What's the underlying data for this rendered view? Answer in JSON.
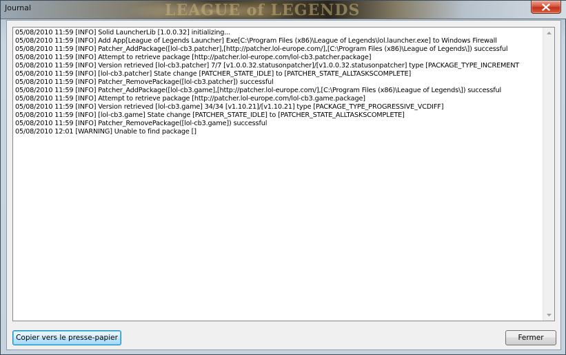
{
  "window": {
    "title": "Journal",
    "background_art_text": "LEAGUE of LEGENDS"
  },
  "log": {
    "lines": [
      "05/08/2010 11:59 [INFO] Solid LauncherLib [1.0.0.32] initializing...",
      "05/08/2010 11:59 [INFO] Add App[League of Legends Launcher] Exe[C:\\Program Files (x86)\\League of Legends\\lol.launcher.exe] to Windows Firewall",
      "05/08/2010 11:59 [INFO] Patcher_AddPackage([lol-cb3.patcher],[http://patcher.lol-europe.com/],[C:\\Program Files (x86)\\League of Legends\\]) successful",
      "05/08/2010 11:59 [INFO] Attempt to retrieve package [http://patcher.lol-europe.com/lol-cb3.patcher.package]",
      "05/08/2010 11:59 [INFO] Version retrieved [lol-cb3.patcher] 7/7 [v1.0.0.32.statusonpatcher]/[v1.0.0.32.statusonpatcher] type [PACKAGE_TYPE_INCREMENT",
      "05/08/2010 11:59 [INFO] [lol-cb3.patcher] State change [PATCHER_STATE_IDLE] to [PATCHER_STATE_ALLTASKSCOMPLETE]",
      "05/08/2010 11:59 [INFO] Patcher_RemovePackage([lol-cb3.patcher]) successful",
      "05/08/2010 11:59 [INFO] Patcher_AddPackage([lol-cb3.game],[http://patcher.lol-europe.com/],[C:\\Program Files (x86)\\League of Legends\\]) successful",
      "05/08/2010 11:59 [INFO] Attempt to retrieve package [http://patcher.lol-europe.com/lol-cb3.game.package]",
      "05/08/2010 11:59 [INFO] Version retrieved [lol-cb3.game] 34/34 [v1.10.21]/[v1.10.21] type [PACKAGE_TYPE_PROGRESSIVE_VCDIFF]",
      "05/08/2010 11:59 [INFO] [lol-cb3.game] State change [PATCHER_STATE_IDLE] to [PATCHER_STATE_ALLTASKSCOMPLETE]",
      "05/08/2010 11:59 [INFO] Patcher_RemovePackage([lol-cb3.game]) successful",
      "05/08/2010 12:01 [WARNING] Unable to find package []"
    ]
  },
  "buttons": {
    "copy_label": "Copier vers le presse-papier",
    "close_label": "Fermer"
  },
  "icons": {
    "close": "close-icon",
    "scroll_up": "scroll-up-arrow-icon",
    "scroll_down": "scroll-down-arrow-icon"
  },
  "colors": {
    "close_button": "#c8391f",
    "focused_button_border": "#3c7fb1"
  }
}
